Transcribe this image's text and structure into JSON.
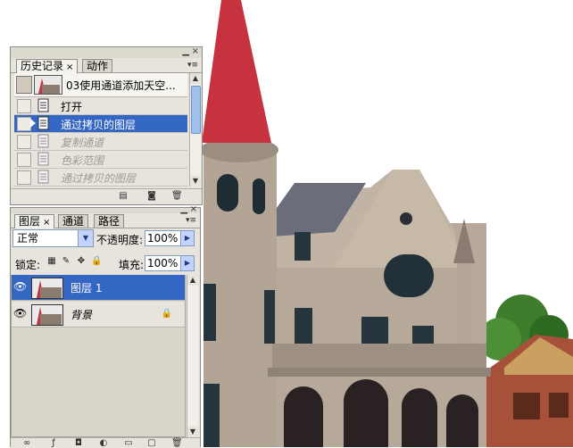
{
  "history_panel": {
    "tabs": [
      {
        "label": "历史记录",
        "close": "×"
      },
      {
        "label": "动作"
      }
    ],
    "snapshot_label": "03使用通道添加天空...",
    "items": [
      {
        "label": "打开",
        "state": "normal"
      },
      {
        "label": "通过拷贝的图层",
        "state": "selected"
      },
      {
        "label": "复制通道",
        "state": "disabled"
      },
      {
        "label": "色彩范围",
        "state": "disabled"
      },
      {
        "label": "通过拷贝的图层",
        "state": "disabled"
      }
    ],
    "footer_icons": [
      "new-document-from-state-icon",
      "camera-icon",
      "trash-icon"
    ]
  },
  "layers_panel": {
    "tabs": [
      {
        "label": "图层",
        "close": "×"
      },
      {
        "label": "通道"
      },
      {
        "label": "路径"
      }
    ],
    "blend_mode": "正常",
    "opacity_label": "不透明度:",
    "opacity_value": "100%",
    "lock_label": "锁定:",
    "fill_label": "填充:",
    "fill_value": "100%",
    "layers": [
      {
        "name": "图层 1",
        "selected": true,
        "visible": true
      },
      {
        "name": "背景",
        "selected": false,
        "visible": true,
        "locked": true
      }
    ],
    "footer_icons": [
      "link-icon",
      "fx-icon",
      "mask-icon",
      "adjustment-icon",
      "folder-icon",
      "new-layer-icon",
      "trash-icon"
    ]
  },
  "colors": {
    "selection": "#3466c4",
    "panel_bg": "#e6e4dc",
    "roof_red": "#c6333e"
  }
}
